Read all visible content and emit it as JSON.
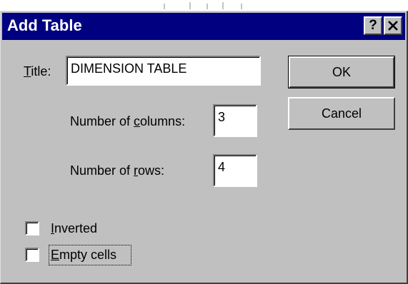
{
  "window": {
    "title": "Add Table",
    "help_label": "?",
    "active_titlebar_color": "#000080",
    "dialog_face_color": "#c0c0c0"
  },
  "form": {
    "title_label_mnemonic": "T",
    "title_label_rest": "itle:",
    "title_value": "DIMENSION TABLE",
    "columns_label_before": "Number of ",
    "columns_label_mnemonic": "c",
    "columns_label_after": "olumns:",
    "columns_value": "3",
    "rows_label_before": "Number of ",
    "rows_label_mnemonic": "r",
    "rows_label_after": "ows:",
    "rows_value": "4"
  },
  "buttons": {
    "ok_label": "OK",
    "cancel_label": "Cancel"
  },
  "options": {
    "inverted_mnemonic": "I",
    "inverted_rest": "nverted",
    "inverted_checked": false,
    "empty_cells_mnemonic": "E",
    "empty_cells_rest": "mpty cells",
    "empty_cells_checked": false,
    "focused_option": "empty_cells"
  },
  "icons": {
    "close": "close-icon",
    "help": "help-icon"
  }
}
